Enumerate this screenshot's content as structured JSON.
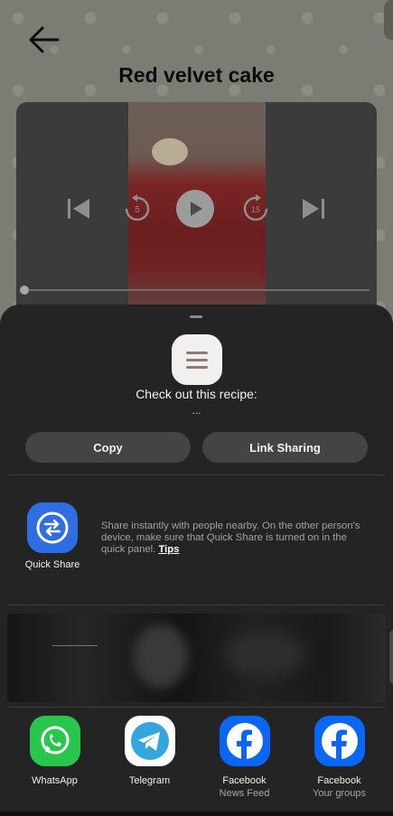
{
  "page": {
    "title": "Red velvet cake"
  },
  "share_sheet": {
    "message": "Check out this recipe:",
    "message_sub": "...",
    "buttons": {
      "copy": "Copy",
      "link_sharing": "Link Sharing"
    },
    "quick_share": {
      "label": "Quick Share",
      "description": "Share instantly with people nearby. On the other person's device, make sure that Quick Share is turned on in the quick panel.",
      "tips": "Tips"
    },
    "apps": [
      {
        "name": "WhatsApp",
        "sub": "",
        "icon": "whatsapp-icon"
      },
      {
        "name": "Telegram",
        "sub": "",
        "icon": "telegram-icon"
      },
      {
        "name": "Facebook",
        "sub": "News Feed",
        "icon": "facebook-icon"
      },
      {
        "name": "Facebook",
        "sub": "Your groups",
        "icon": "facebook-icon"
      }
    ]
  },
  "video": {
    "rewind_seconds": "5",
    "forward_seconds": "15",
    "progress": 0
  },
  "colors": {
    "quick_share_blue": "#2f6de3",
    "whatsapp_green": "#28c64b",
    "facebook_blue": "#0a66f5",
    "sheet_bg": "#242424"
  }
}
